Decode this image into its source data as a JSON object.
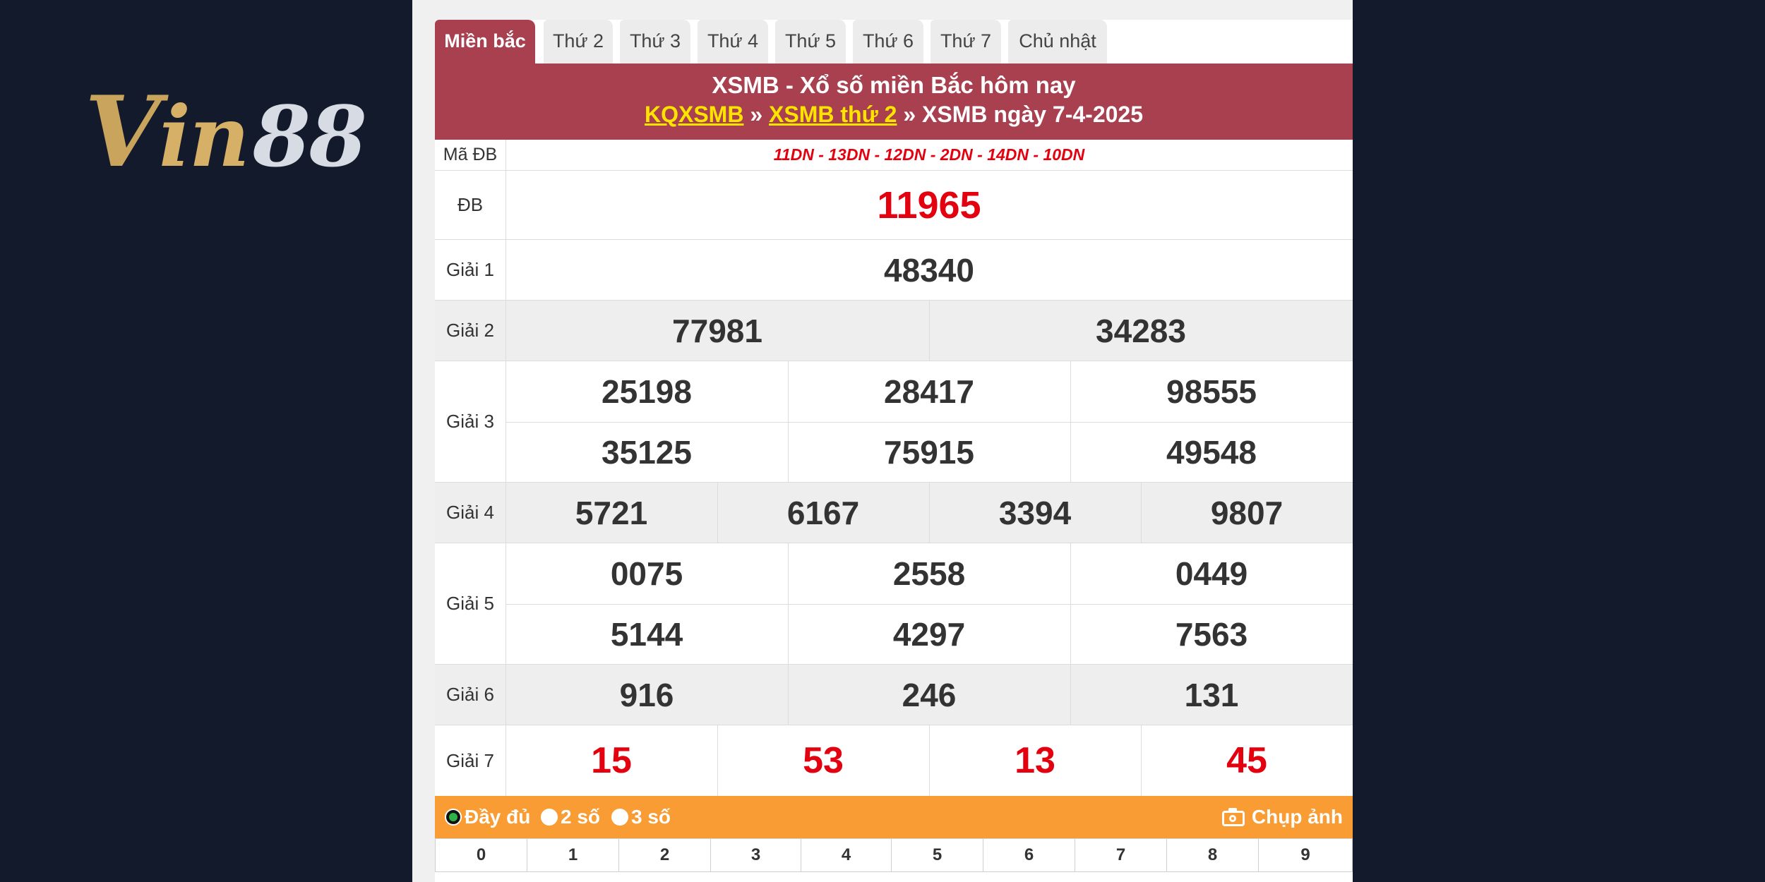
{
  "logo": {
    "text": "Vin88",
    "v": "V",
    "in": "in",
    "num": "88"
  },
  "tabs": [
    "Miền bắc",
    "Thứ 2",
    "Thứ 3",
    "Thứ 4",
    "Thứ 5",
    "Thứ 6",
    "Thứ 7",
    "Chủ nhật"
  ],
  "active_tab": "Miền bắc",
  "header": {
    "title": "XSMB - Xổ số miền Bắc hôm nay",
    "crumb1": "KQXSMB",
    "sep": "»",
    "crumb2": "XSMB thứ 2",
    "current": "XSMB ngày 7-4-2025"
  },
  "ma_db": {
    "label": "Mã ĐB",
    "value": "11DN - 13DN - 12DN - 2DN - 14DN - 10DN"
  },
  "prizes": {
    "db": {
      "label": "ĐB",
      "values": [
        "11965"
      ]
    },
    "g1": {
      "label": "Giải 1",
      "values": [
        "48340"
      ]
    },
    "g2": {
      "label": "Giải 2",
      "values": [
        "77981",
        "34283"
      ]
    },
    "g3": {
      "label": "Giải 3",
      "values": [
        "25198",
        "28417",
        "98555",
        "35125",
        "75915",
        "49548"
      ]
    },
    "g4": {
      "label": "Giải 4",
      "values": [
        "5721",
        "6167",
        "3394",
        "9807"
      ]
    },
    "g5": {
      "label": "Giải 5",
      "values": [
        "0075",
        "2558",
        "0449",
        "5144",
        "4297",
        "7563"
      ]
    },
    "g6": {
      "label": "Giải 6",
      "values": [
        "916",
        "246",
        "131"
      ]
    },
    "g7": {
      "label": "Giải 7",
      "values": [
        "15",
        "53",
        "13",
        "45"
      ]
    }
  },
  "options": {
    "full": "Đầy đủ",
    "two": "2 số",
    "three": "3 số",
    "selected": "Đầy đủ"
  },
  "snapshot": "Chụp ảnh",
  "digits": [
    "0",
    "1",
    "2",
    "3",
    "4",
    "5",
    "6",
    "7",
    "8",
    "9"
  ],
  "colors": {
    "header": "#a8404f",
    "accent_red": "#e3000f",
    "orange_bar": "#f99c33",
    "background": "#131a2b"
  }
}
